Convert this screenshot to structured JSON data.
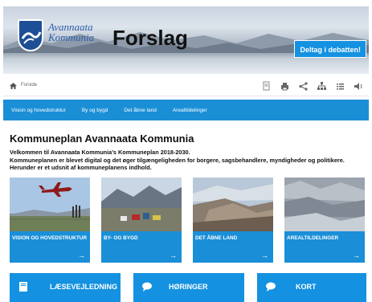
{
  "header": {
    "logo_line1": "Avannaata",
    "logo_line2": "Kommunia",
    "title": "Forslag",
    "cta_label": "Deltag i debatten!"
  },
  "breadcrumb": {
    "current": "Forside"
  },
  "nav": {
    "items": [
      "Vision og hovedstruktur",
      "By og bygd",
      "Det åbne land",
      "Arealtildelinger"
    ]
  },
  "main": {
    "heading": "Kommuneplan Avannaata Kommunia",
    "intro_line1": "Velkommen til Avannaata Kommunia's Kommuneplan 2018-2030.",
    "intro_line2": "Kommuneplanen er blevet digital og det øger tilgængeligheden for borgere, sagsbehandlere, myndigheder og politikere.",
    "intro_line3": "Herunder er et udsnit af kommuneplanens indhold."
  },
  "cards": [
    {
      "label": "VISION OG HOVEDSTRUKTUR"
    },
    {
      "label": "BY- OG BYGD"
    },
    {
      "label": "DET ÅBNE LAND"
    },
    {
      "label": "AREALTILDELINGER"
    }
  ],
  "tiles": [
    {
      "label": "LÆSEVEJLEDNING",
      "icon": "book-icon"
    },
    {
      "label": "HØRINGER",
      "icon": "chat-icon"
    },
    {
      "label": "KORT",
      "icon": "chat-icon"
    }
  ],
  "colors": {
    "accent": "#1491e0",
    "nav": "#1b8fd6",
    "logo_blue": "#1e4f96"
  }
}
